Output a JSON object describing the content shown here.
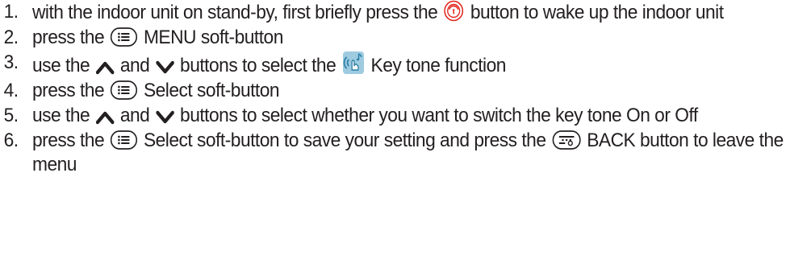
{
  "steps": [
    {
      "number": "1.",
      "before": "with the indoor unit on stand-by, first briefly press the",
      "after": "button to wake up the indoor unit",
      "icon": "power-button-icon"
    },
    {
      "number": "2.",
      "before": "press the",
      "after": "MENU soft-button",
      "icon": "menu-soft-button-icon"
    },
    {
      "number": "3.",
      "before": "use the",
      "mid1": "and",
      "mid2": "buttons to select the",
      "after": "Key tone function",
      "icons": [
        "up-arrow-icon",
        "down-arrow-icon",
        "key-tone-function-icon"
      ]
    },
    {
      "number": "4.",
      "before": "press the",
      "after": "Select soft-button",
      "icon": "menu-soft-button-icon"
    },
    {
      "number": "5.",
      "before": "use the",
      "mid1": "and",
      "after": "buttons to select whether you want to switch the key tone On or Off",
      "icons": [
        "up-arrow-icon",
        "down-arrow-icon"
      ]
    },
    {
      "number": "6.",
      "before": "press the",
      "mid1": "Select soft-button to save your setting and press the",
      "after": "BACK button to leave the menu",
      "icons": [
        "menu-soft-button-icon",
        "back-button-icon"
      ]
    }
  ],
  "colors": {
    "text": "#231f20",
    "power_icon": "#e2231a",
    "key_tone_icon_bg": "#9ecbe0",
    "key_tone_icon_fg": "#2b7fa8"
  }
}
